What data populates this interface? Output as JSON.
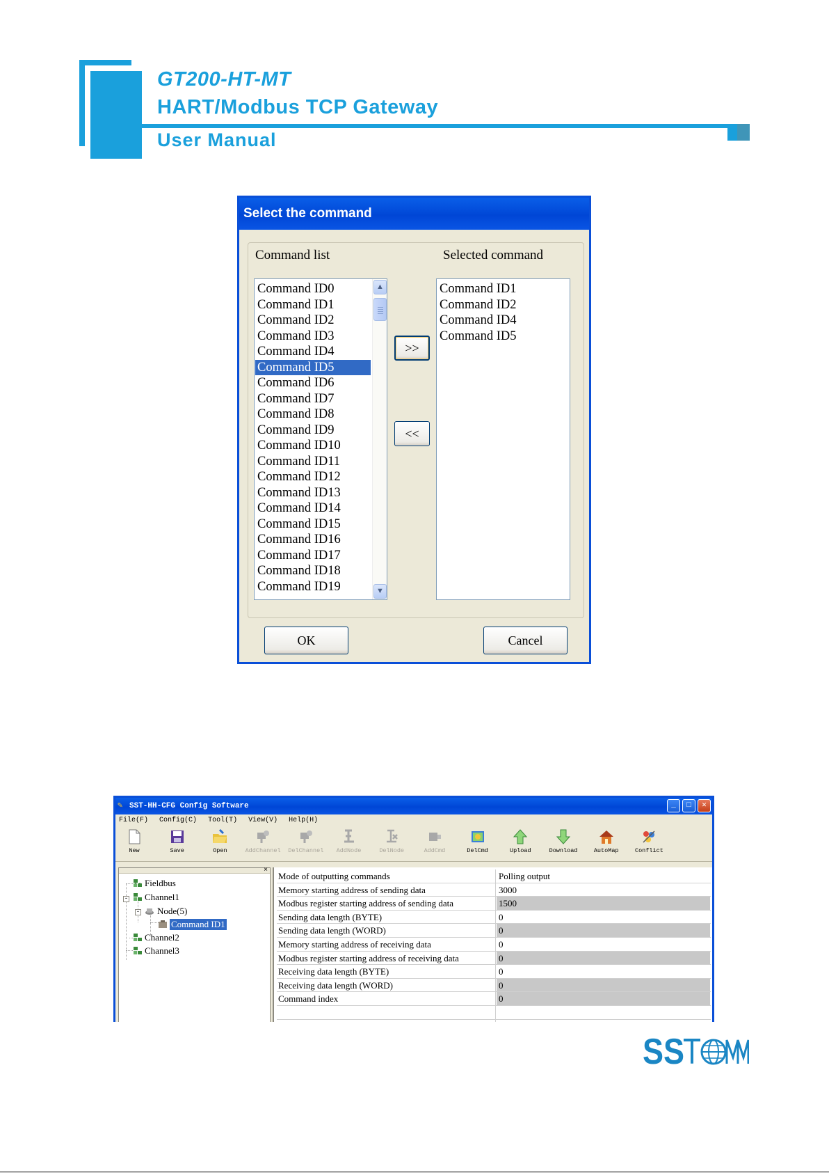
{
  "header": {
    "model": "GT200-HT-MT",
    "product": "HART/Modbus TCP  Gateway",
    "doc_type": "User Manual"
  },
  "dialog": {
    "title": "Select the command",
    "command_list_label": "Command list",
    "selected_label": "Selected command",
    "command_list": [
      "Command ID0",
      "Command ID1",
      "Command ID2",
      "Command ID3",
      "Command ID4",
      "Command ID5",
      "Command ID6",
      "Command ID7",
      "Command ID8",
      "Command ID9",
      "Command ID10",
      "Command ID11",
      "Command ID12",
      "Command ID13",
      "Command ID14",
      "Command ID15",
      "Command ID16",
      "Command ID17",
      "Command ID18",
      "Command ID19"
    ],
    "highlighted_item": "Command ID5",
    "selected_commands": [
      "Command ID1",
      "Command ID2",
      "Command ID4",
      "Command ID5"
    ],
    "add_button": ">>",
    "remove_button": "<<",
    "ok_button": "OK",
    "cancel_button": "Cancel"
  },
  "app": {
    "title": "SST-HH-CFG Config Software",
    "menu": [
      "File(F)",
      "Config(C)",
      "Tool(T)",
      "View(V)",
      "Help(H)"
    ],
    "toolbar": [
      {
        "label": "New",
        "icon": "new-document-icon",
        "enabled": true
      },
      {
        "label": "Save",
        "icon": "save-disk-icon",
        "enabled": true
      },
      {
        "label": "Open",
        "icon": "open-folder-icon",
        "enabled": true
      },
      {
        "label": "AddChannel",
        "icon": "add-channel-icon",
        "enabled": false
      },
      {
        "label": "DelChannel",
        "icon": "delete-channel-icon",
        "enabled": false
      },
      {
        "label": "AddNode",
        "icon": "add-node-icon",
        "enabled": false
      },
      {
        "label": "DelNode",
        "icon": "delete-node-icon",
        "enabled": false
      },
      {
        "label": "AddCmd",
        "icon": "add-command-icon",
        "enabled": false
      },
      {
        "label": "DelCmd",
        "icon": "delete-command-icon",
        "enabled": true
      },
      {
        "label": "Upload",
        "icon": "upload-arrow-icon",
        "enabled": true
      },
      {
        "label": "Download",
        "icon": "download-arrow-icon",
        "enabled": true
      },
      {
        "label": "AutoMap",
        "icon": "automap-house-icon",
        "enabled": true
      },
      {
        "label": "Conflict",
        "icon": "conflict-icon",
        "enabled": true
      }
    ],
    "tree": {
      "fieldbus": "Fieldbus",
      "channel1": "Channel1",
      "node": "Node(5)",
      "command": "Command ID1",
      "channel2": "Channel2",
      "channel3": "Channel3"
    },
    "properties": [
      {
        "name": "Mode of outputting commands",
        "value": "Polling output",
        "readonly": false
      },
      {
        "name": "Memory starting address of sending data",
        "value": "3000",
        "readonly": false
      },
      {
        "name": "Modbus register starting address of sending data",
        "value": "1500",
        "readonly": true
      },
      {
        "name": "Sending data length (BYTE)",
        "value": "0",
        "readonly": false
      },
      {
        "name": "Sending data length (WORD)",
        "value": "0",
        "readonly": true
      },
      {
        "name": "Memory starting address of receiving data",
        "value": "0",
        "readonly": false
      },
      {
        "name": "Modbus register starting address of receiving data",
        "value": "0",
        "readonly": true
      },
      {
        "name": "Receiving data length (BYTE)",
        "value": "0",
        "readonly": false
      },
      {
        "name": "Receiving data length (WORD)",
        "value": "0",
        "readonly": true
      },
      {
        "name": "Command index",
        "value": "0",
        "readonly": true
      }
    ]
  },
  "footer": {
    "logo_text": "SSTCOMM"
  },
  "colors": {
    "brand_blue": "#1aa0dc",
    "xp_title": "#0a4fd8",
    "selection": "#316ac5",
    "readonly_cell": "#c8c8c8"
  }
}
